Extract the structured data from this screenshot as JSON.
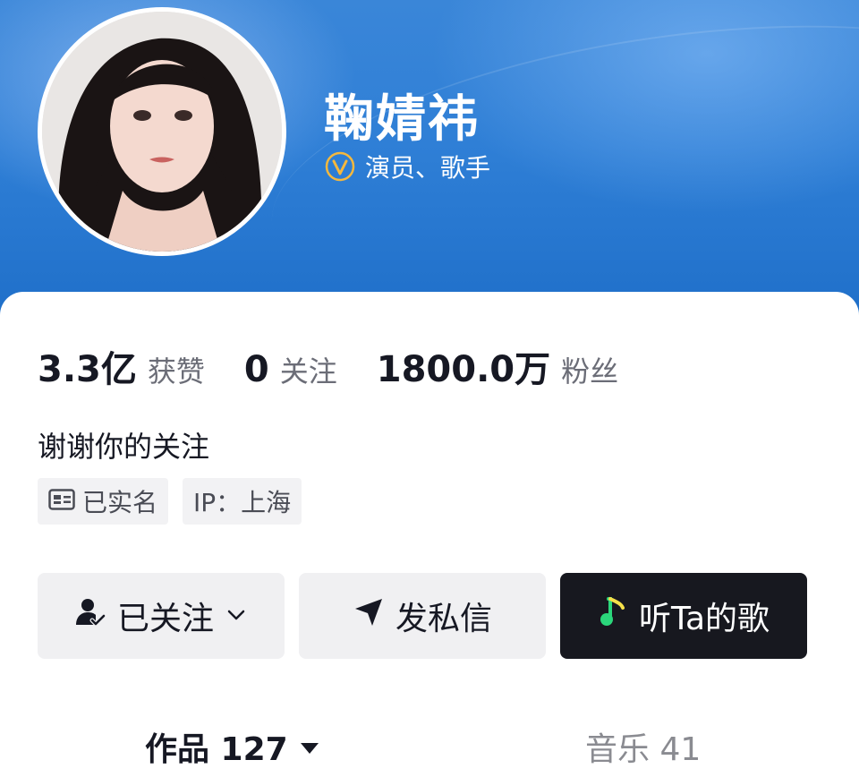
{
  "profile": {
    "name": "鞠婧祎",
    "verified_title": "演员、歌手",
    "avatar": "avatar-photo",
    "verify_icon": "verified-v-icon"
  },
  "stats": {
    "likes_value": "3.3亿",
    "likes_label": "获赞",
    "following_value": "0",
    "following_label": "关注",
    "followers_value": "1800.0万",
    "followers_label": "粉丝"
  },
  "bio": "谢谢你的关注",
  "tags": {
    "real_name": "已实名",
    "ip": "IP：上海"
  },
  "actions": {
    "follow_label": "已关注",
    "message_label": "发私信",
    "music_label": "听Ta的歌"
  },
  "tabs": {
    "works_label": "作品 127",
    "music_label": "音乐 41"
  },
  "colors": {
    "header_blue": "#2f7fd6",
    "dark_button": "#17181f",
    "verify_gold": "#f5b83d",
    "music_green": "#2bd67b"
  }
}
